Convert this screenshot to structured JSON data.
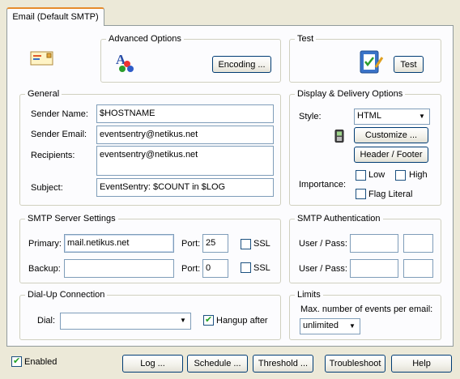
{
  "tab": {
    "label": "Email (Default SMTP)"
  },
  "advanced": {
    "legend": "Advanced Options",
    "encoding_button": "Encoding ..."
  },
  "test": {
    "legend": "Test",
    "test_button": "Test"
  },
  "general": {
    "legend": "General",
    "sender_name_label": "Sender Name:",
    "sender_name_value": "$HOSTNAME",
    "sender_email_label": "Sender Email:",
    "sender_email_value": "eventsentry@netikus.net",
    "recipients_label": "Recipients:",
    "recipients_value": "eventsentry@netikus.net",
    "subject_label": "Subject:",
    "subject_value": "EventSentry: $COUNT in $LOG"
  },
  "display": {
    "legend": "Display & Delivery Options",
    "style_label": "Style:",
    "style_value": "HTML",
    "customize_button": "Customize ...",
    "header_footer_button": "Header / Footer",
    "importance_label": "Importance:",
    "low_label": "Low",
    "high_label": "High",
    "flag_literal_label": "Flag Literal",
    "low_checked": false,
    "high_checked": false,
    "flag_literal_checked": false
  },
  "smtp": {
    "legend": "SMTP Server Settings",
    "primary_label": "Primary:",
    "primary_value": "mail.netikus.net",
    "primary_port_label": "Port:",
    "primary_port_value": "25",
    "primary_ssl_label": "SSL",
    "backup_label": "Backup:",
    "backup_value": "",
    "backup_port_label": "Port:",
    "backup_port_value": "0",
    "backup_ssl_label": "SSL"
  },
  "auth": {
    "legend": "SMTP Authentication",
    "user_pass_label_1": "User / Pass:",
    "user_pass_label_2": "User / Pass:"
  },
  "dialup": {
    "legend": "Dial-Up Connection",
    "dial_label": "Dial:",
    "dial_value": "",
    "hangup_label": "Hangup after",
    "hangup_checked": true
  },
  "limits": {
    "legend": "Limits",
    "max_label": "Max. number of events per email:",
    "max_value": "unlimited"
  },
  "footer": {
    "enabled_label": "Enabled",
    "enabled_checked": true,
    "log_button": "Log ...",
    "schedule_button": "Schedule ...",
    "threshold_button": "Threshold ...",
    "troubleshoot_button": "Troubleshoot",
    "help_button": "Help"
  }
}
